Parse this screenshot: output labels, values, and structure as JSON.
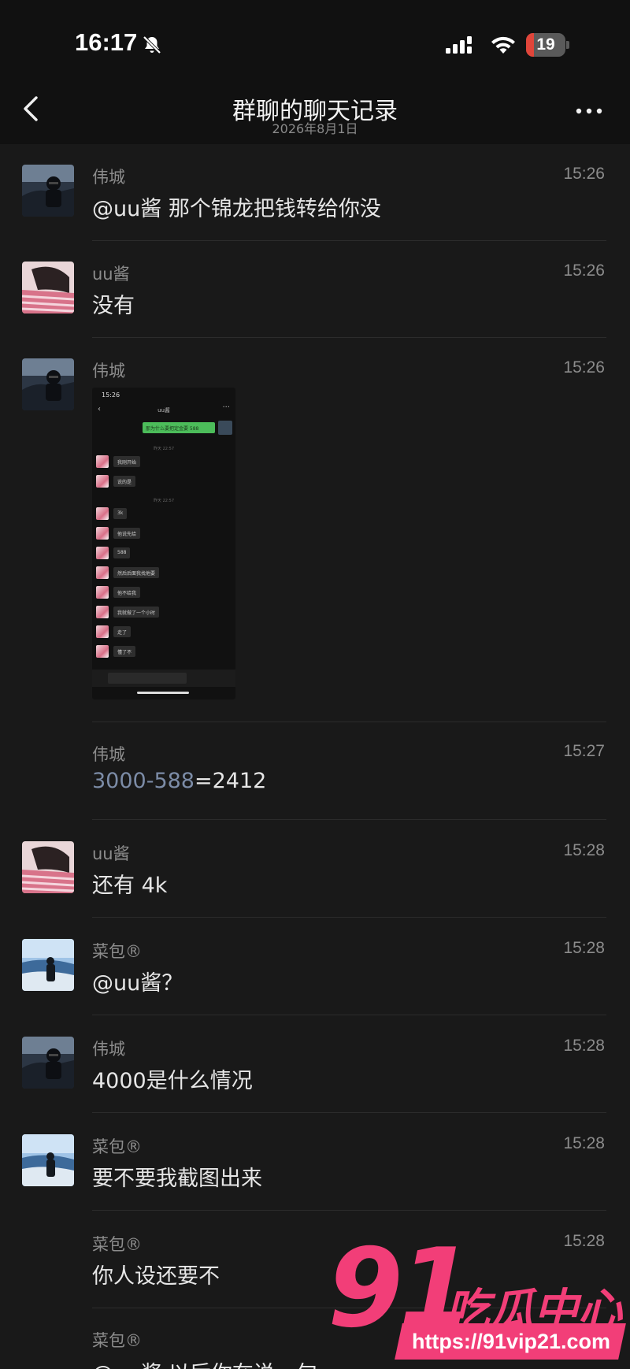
{
  "status_bar": {
    "time": "16:17",
    "battery": "19",
    "battery_level": 0.19
  },
  "nav": {
    "title": "群聊的聊天记录",
    "subtitle": "2026年8月1日"
  },
  "messages": [
    {
      "sender": "伟城",
      "time": "15:26",
      "mention": "@uu酱",
      "text": " 那个锦龙把钱转给你没",
      "avatar": "avatar-car-man"
    },
    {
      "sender": "uu酱",
      "time": "15:26",
      "text": "没有",
      "avatar": "avatar-pink-girl"
    },
    {
      "sender": "伟城",
      "time": "15:26",
      "avatar": "avatar-car-man",
      "image": "chat-screenshot"
    },
    {
      "sender": "伟城",
      "time": "15:27",
      "formula_left": "3000-588",
      "formula_right": "=2412"
    },
    {
      "sender": "uu酱",
      "time": "15:28",
      "text": "还有 4k",
      "avatar": "avatar-pink-girl"
    },
    {
      "sender": "菜包®",
      "time": "15:28",
      "text": "@uu酱？",
      "avatar": "avatar-snow-man"
    },
    {
      "sender": "伟城",
      "time": "15:28",
      "text": "4000是什么情况",
      "avatar": "avatar-car-man"
    },
    {
      "sender": "菜包®",
      "time": "15:28",
      "text": "要不要我截图出来",
      "avatar": "avatar-snow-man"
    },
    {
      "sender": "菜包®",
      "time": "15:28",
      "text": "你人设还要不"
    },
    {
      "sender": "菜包®",
      "time": "",
      "text": "@uu酱 以后你在说一句"
    }
  ],
  "embedded_screenshot": {
    "time": "15:26",
    "title": "uu酱",
    "sent_message": "那为什么要把定金要 588",
    "stamp_1": "昨天 22:57",
    "stamp_2": "昨天 22:57",
    "replies": [
      "我刚开始",
      "说的是",
      "3k",
      "他说先给",
      "588",
      "然后后面我找他要",
      "他不给我",
      "我就做了一个小时",
      "走了",
      "懂了不"
    ]
  },
  "watermark": {
    "logo": "91",
    "name": "吃瓜中心",
    "url": "https://91vip21.com"
  },
  "colors": {
    "background": "#191919",
    "header": "#111111",
    "mention": "#7c8ca7",
    "battery_low": "#e0453a",
    "watermark": "#f23e78"
  }
}
